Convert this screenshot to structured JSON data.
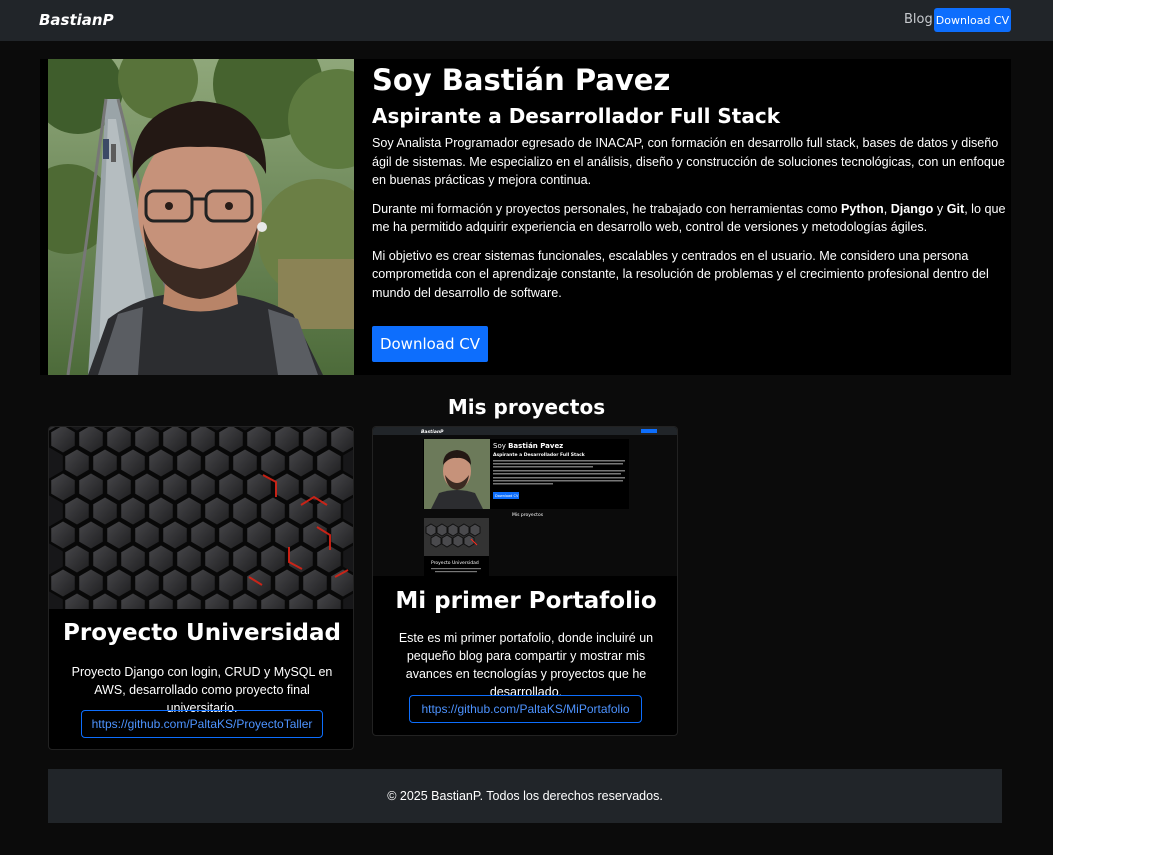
{
  "nav": {
    "brand": "BastianP",
    "blog_link": "Blog",
    "download_button": "Download CV"
  },
  "hero": {
    "name": "Soy Bastián Pavez",
    "role": "Aspirante a Desarrollador Full Stack",
    "paragraph1": "Soy Analista Programador egresado de INACAP, con formación en desarrollo full stack, bases de datos y diseño ágil de sistemas.  Me especializo en el análisis, diseño y construcción de soluciones tecnológicas, con un enfoque en buenas prácticas y mejora continua.",
    "paragraph2_before": "Durante mi formación y proyectos personales, he trabajado con herramientas como ",
    "tool1": "Python",
    "sep1": ", ",
    "tool2": "Django",
    "sep2": " y ",
    "tool3": "Git",
    "paragraph2_after": ", lo que me ha permitido adquirir experiencia en desarrollo web, control de versiones y metodologías ágiles.",
    "paragraph3": "Mi objetivo es crear sistemas funcionales, escalables y centrados en el usuario.  Me considero una persona comprometida con el aprendizaje constante, la resolución de problemas y el crecimiento profesional dentro del mundo del desarrollo de software.",
    "download_button": "Download CV"
  },
  "projects": {
    "title": "Mis proyectos",
    "items": [
      {
        "title": "Proyecto Universidad",
        "description": "Proyecto Django con login, CRUD y MySQL en AWS, desarrollado como proyecto final universitario.",
        "link": "https://github.com/PaltaKS/ProyectoTaller"
      },
      {
        "title": "Mi primer Portafolio",
        "description": "Este es mi primer portafolio, donde incluiré un pequeño blog para compartir y mostrar mis avances en tecnologías y proyectos que he desarrollado.",
        "link": "https://github.com/PaltaKS/MiPortafolio"
      }
    ]
  },
  "preview": {
    "brand": "BastianP",
    "name_prefix": "Soy ",
    "name_bold": "Bastián Pavez",
    "role": "Aspirante a Desarrollador Full Stack",
    "button": "Download CV",
    "section": "Mis proyectos",
    "card_title": "Proyecto Universidad"
  },
  "footer": {
    "text": "© 2025 BastianP. Todos los derechos reservados."
  },
  "colors": {
    "accent": "#0d6efd",
    "navbar": "#212529",
    "background": "#0b0b0b"
  }
}
